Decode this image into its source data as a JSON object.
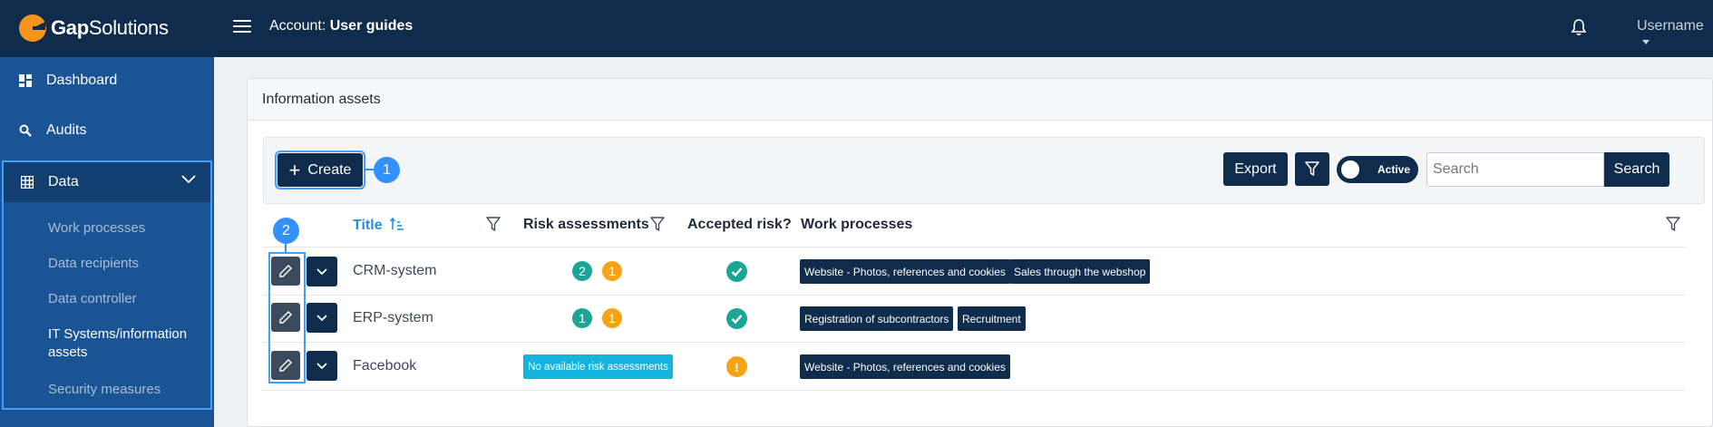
{
  "brand": {
    "name_bold": "Gap",
    "name_light": "Solutions",
    "accent": "#f7941d"
  },
  "header": {
    "account_prefix": "Account:",
    "account_name": "User guides",
    "username": "Username"
  },
  "sidebar": {
    "items": [
      {
        "label": "Dashboard",
        "icon": "dashboard-icon"
      },
      {
        "label": "Audits",
        "icon": "search-icon"
      },
      {
        "label": "Data",
        "icon": "table-icon"
      }
    ],
    "data_sub": [
      "Work processes",
      "Data recipients",
      "Data controller",
      "IT Systems/information assets",
      "Security measures"
    ],
    "active_sub": "IT Systems/information assets"
  },
  "page": {
    "title": "Information assets"
  },
  "toolbar": {
    "create_label": "Create",
    "export_label": "Export",
    "toggle_label": "Active",
    "search_placeholder": "Search",
    "search_button": "Search"
  },
  "callouts": [
    "1",
    "2"
  ],
  "table": {
    "headers": {
      "title": "Title",
      "risk": "Risk assessments",
      "accepted": "Accepted risk?",
      "work": "Work processes"
    },
    "rows": [
      {
        "title": "CRM-system",
        "risk_green": "2",
        "risk_orange": "1",
        "accepted": "check",
        "work": [
          "Website - Photos, references and cookies",
          "Sales through the webshop"
        ]
      },
      {
        "title": "ERP-system",
        "risk_green": "1",
        "risk_orange": "1",
        "accepted": "check",
        "work": [
          "Registration of subcontractors",
          "Recruitment"
        ]
      },
      {
        "title": "Facebook",
        "risk_none": "No available risk assessments",
        "accepted": "!",
        "work": [
          "Website - Photos, references and cookies"
        ]
      }
    ]
  }
}
